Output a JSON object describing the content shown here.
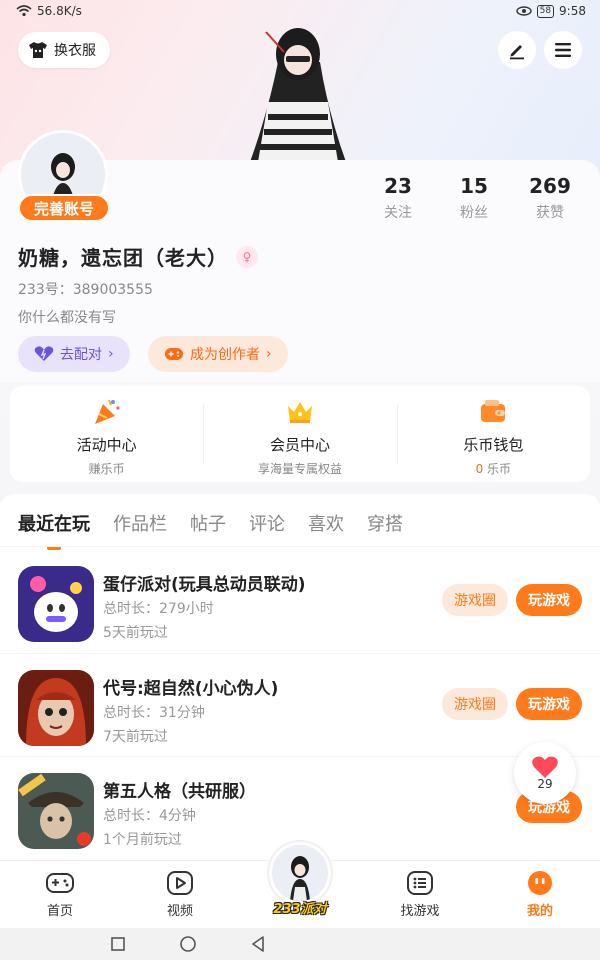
{
  "status_bar": {
    "speed": "56.8K/s",
    "battery": "58",
    "time": "9:58"
  },
  "header": {
    "outfit_label": "换衣服"
  },
  "profile": {
    "badge": "完善账号",
    "nickname": "奶糖，遗忘团（老大）",
    "user_id": "233号：389003555",
    "bio": "你什么都没有写",
    "stats": [
      {
        "value": "23",
        "label": "关注"
      },
      {
        "value": "15",
        "label": "粉丝"
      },
      {
        "value": "269",
        "label": "获赞"
      }
    ],
    "match_label": "去配对",
    "creator_label": "成为创作者"
  },
  "features": [
    {
      "title": "活动中心",
      "sub": "赚乐币"
    },
    {
      "title": "会员中心",
      "sub": "享海量专属权益"
    },
    {
      "title": "乐币钱包",
      "sub_value": "0",
      "sub_unit": "乐币"
    }
  ],
  "tabs": [
    "最近在玩",
    "作品栏",
    "帖子",
    "评论",
    "喜欢",
    "穿搭"
  ],
  "games": [
    {
      "title": "蛋仔派对(玩具总动员联动)",
      "time": "总时长：279小时",
      "last": "5天前玩过",
      "circle": "游戏圈",
      "play": "玩游戏"
    },
    {
      "title": "代号:超自然(小心伪人)",
      "time": "总时长：31分钟",
      "last": "7天前玩过",
      "circle": "游戏圈",
      "play": "玩游戏"
    },
    {
      "title": "第五人格（共研服）",
      "time": "总时长：4分钟",
      "last": "1个月前玩过",
      "play": "玩游戏"
    }
  ],
  "like_count": "29",
  "bottom_nav": {
    "home": "首页",
    "video": "视频",
    "center": "233派对",
    "find": "找游戏",
    "mine": "我的"
  },
  "colors": {
    "accent": "#ff7a1a",
    "purple": "#6b54d8"
  }
}
